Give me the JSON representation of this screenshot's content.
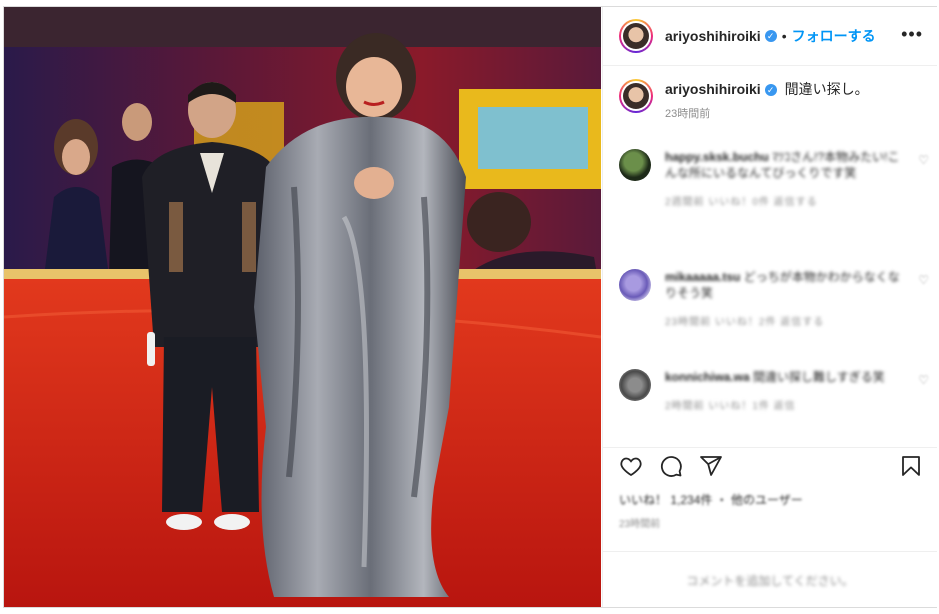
{
  "post": {
    "photo_alt": "photo",
    "colors": {
      "floor": "#c81d14",
      "wall": "#6b1a2a",
      "accent": "#e9b91c",
      "link": "#0095f6"
    }
  },
  "header": {
    "username": "ariyoshihiroiki",
    "separator": "•",
    "follow_label": "フォローする",
    "more_icon": "more-icon"
  },
  "caption": {
    "username": "ariyoshihiroiki",
    "text": "間違い探し。",
    "time": "23時間前"
  },
  "comments": [
    {
      "user": "happy.sksk.buchu",
      "text": "ﾏﾂｺさん!?本物みたい!こんな所にいるなんてびっくりです笑",
      "meta": "2週間前  いいね！0件  返信する"
    },
    {
      "user": "mikaaaaa.tsu",
      "text": "どっちが本物かわからなくなりそう笑",
      "meta": "23時間前  いいね！2件  返信する"
    },
    {
      "user": "konnichiwa.wa",
      "text": "間違い探し難しすぎる笑",
      "meta": "2時間前  いいね！1件  返信"
    }
  ],
  "actions": {
    "like_icon": "heart-icon",
    "comment_icon": "comment-icon",
    "share_icon": "share-icon",
    "save_icon": "bookmark-icon"
  },
  "likes": {
    "text": "いいね！ 1,234件 ・ 他のユーザー",
    "sub": "23時間前"
  },
  "footer": {
    "text": "コメントを追加してください。"
  }
}
